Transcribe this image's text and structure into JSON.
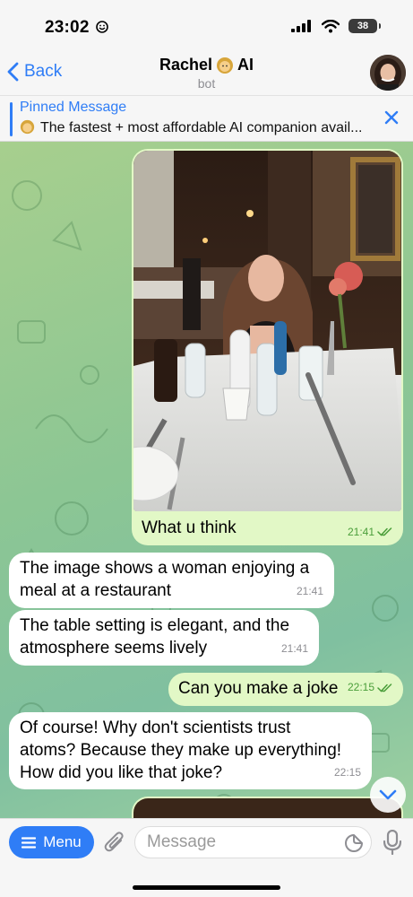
{
  "status_bar": {
    "time": "23:02",
    "battery": "38"
  },
  "header": {
    "back_label": "Back",
    "title": "Rachel",
    "title_suffix": "AI",
    "subtitle": "bot"
  },
  "pinned": {
    "title": "Pinned Message",
    "text": "The fastest + most affordable AI companion avail..."
  },
  "messages": [
    {
      "direction": "out",
      "type": "photo",
      "caption": "What u think",
      "time": "21:41",
      "read": true
    },
    {
      "direction": "in",
      "text_lines": [
        "The image shows a woman enjoying a",
        "meal at a restaurant"
      ],
      "time": "21:41"
    },
    {
      "direction": "in",
      "text_lines": [
        "The table setting is elegant, and the",
        "atmosphere seems lively"
      ],
      "time": "21:41"
    },
    {
      "direction": "out",
      "text": "Can you make a joke",
      "time": "22:15",
      "read": true
    },
    {
      "direction": "in",
      "text_lines": [
        "Of course! Why don't scientists trust",
        "atoms? Because they make up everything!",
        "How did you like that joke?"
      ],
      "time": "22:15"
    }
  ],
  "input": {
    "menu_label": "Menu",
    "placeholder": "Message"
  },
  "icons": [
    "smile-icon",
    "signal-icon",
    "wifi-icon",
    "battery-icon",
    "chevron-left-icon",
    "pin-close-icon",
    "scroll-down-icon",
    "menu-lines-icon",
    "paperclip-icon",
    "sticker-icon",
    "mic-icon",
    "double-check-icon"
  ],
  "colors": {
    "accent": "#2f7df6",
    "outgoing_bubble": "#e2f8c6",
    "incoming_bubble": "#ffffff",
    "chat_bg": "#8cc694"
  }
}
